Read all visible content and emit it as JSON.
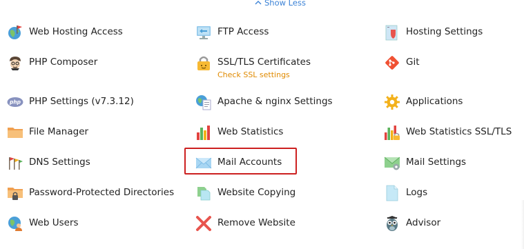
{
  "show_less": {
    "label": "Show Less",
    "icon": "chevron-up-icon"
  },
  "accent_color": "#3b82d6",
  "sublink_color": "#e08a00",
  "highlight_color": "#cc1f1f",
  "items": {
    "web_hosting_access": {
      "label": "Web Hosting Access",
      "icon": "globe-flag-icon"
    },
    "php_composer": {
      "label": "PHP Composer",
      "icon": "composer-icon"
    },
    "php_settings": {
      "label": "PHP Settings (v7.3.12)",
      "icon": "php-icon"
    },
    "file_manager": {
      "label": "File Manager",
      "icon": "folder-icon"
    },
    "dns_settings": {
      "label": "DNS Settings",
      "icon": "dns-flags-icon"
    },
    "password_protected_directories": {
      "label": "Password-Protected Directories",
      "icon": "locked-folder-icon"
    },
    "web_users": {
      "label": "Web Users",
      "icon": "globe-user-icon"
    },
    "ftp_access": {
      "label": "FTP Access",
      "icon": "ftp-monitor-icon"
    },
    "ssl_tls_certificates": {
      "label": "SSL/TLS Certificates",
      "sublink": "Check SSL settings",
      "icon": "padlock-icon"
    },
    "apache_nginx_settings": {
      "label": "Apache & nginx Settings",
      "icon": "globe-document-icon"
    },
    "web_statistics": {
      "label": "Web Statistics",
      "icon": "bar-chart-icon"
    },
    "mail_accounts": {
      "label": "Mail Accounts",
      "icon": "envelope-icon"
    },
    "website_copying": {
      "label": "Website Copying",
      "icon": "copy-pages-icon"
    },
    "remove_website": {
      "label": "Remove Website",
      "icon": "red-x-icon"
    },
    "hosting_settings": {
      "label": "Hosting Settings",
      "icon": "server-shield-icon"
    },
    "git": {
      "label": "Git",
      "icon": "git-icon"
    },
    "applications": {
      "label": "Applications",
      "icon": "gear-icon"
    },
    "web_statistics_ssl": {
      "label": "Web Statistics SSL/TLS",
      "icon": "bar-chart-lock-icon"
    },
    "mail_settings": {
      "label": "Mail Settings",
      "icon": "mail-settings-icon"
    },
    "logs": {
      "label": "Logs",
      "icon": "document-icon"
    },
    "advisor": {
      "label": "Advisor",
      "icon": "owl-icon"
    }
  }
}
